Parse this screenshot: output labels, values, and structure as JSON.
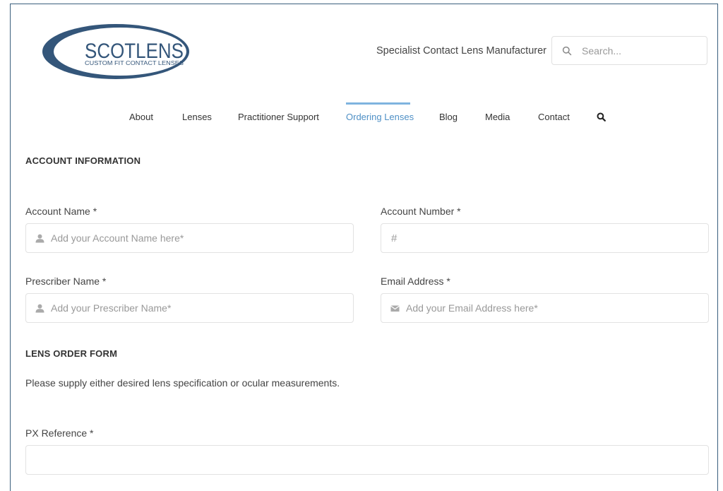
{
  "header": {
    "logo": {
      "brand": "SCOTLENS",
      "sub": "CUSTOM FIT CONTACT LENSES"
    },
    "tagline": "Specialist Contact Lens Manufacturer",
    "search": {
      "placeholder": "Search...",
      "icon": "search-icon"
    }
  },
  "nav": {
    "items": [
      {
        "label": "About",
        "active": false
      },
      {
        "label": "Lenses",
        "active": false
      },
      {
        "label": "Practitioner Support",
        "active": false
      },
      {
        "label": "Ordering Lenses",
        "active": true
      },
      {
        "label": "Blog",
        "active": false
      },
      {
        "label": "Media",
        "active": false
      },
      {
        "label": "Contact",
        "active": false
      }
    ],
    "search_icon": "search-icon",
    "active_color": "#4f90c6"
  },
  "account": {
    "title": "ACCOUNT INFORMATION",
    "account_name": {
      "label": "Account Name *",
      "placeholder": "Add your Account Name here*",
      "icon": "user-icon"
    },
    "account_number": {
      "label": "Account Number *",
      "prefix": "#",
      "placeholder": ""
    },
    "prescriber_name": {
      "label": "Prescriber Name *",
      "placeholder": "Add your Prescriber Name*",
      "icon": "user-icon"
    },
    "email": {
      "label": "Email Address *",
      "placeholder": "Add your Email Address here*",
      "icon": "envelope-icon"
    }
  },
  "lens": {
    "title": "LENS ORDER FORM",
    "description": "Please supply either desired lens specification or ocular measurements.",
    "px_reference": {
      "label": "PX Reference *",
      "placeholder": ""
    }
  },
  "colors": {
    "brand": "#34567a",
    "accent": "#4f90c6",
    "border": "#e2e2e2"
  }
}
